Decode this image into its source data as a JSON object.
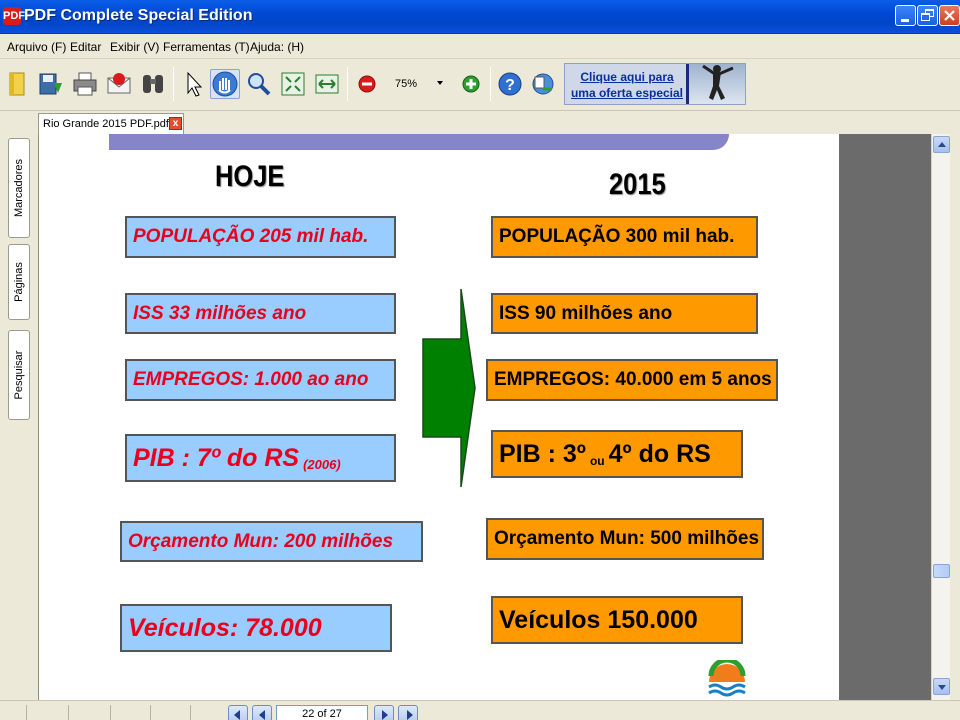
{
  "window": {
    "title": "PDF Complete Special Edition",
    "logo_text": "PDF"
  },
  "menu": [
    "Arquivo (F)",
    "Editar",
    "Exibir (V)",
    "Ferramentas (T)",
    "Ajuda: (H)"
  ],
  "toolbar": {
    "zoom": "75%",
    "tools": [
      "open-icon",
      "save-icon",
      "print-icon",
      "email-icon",
      "find-icon",
      "select-icon",
      "hand-tool-icon",
      "zoom-icon",
      "fit-page-icon",
      "fit-width-icon",
      "zoom-out-icon",
      "zoom-in-icon",
      "help-icon",
      "convert-icon"
    ],
    "ad_text": "Clique aqui para uma oferta especial"
  },
  "tab": {
    "label": "Rio Grande 2015 PDF.pdf",
    "close": "x"
  },
  "side_tabs": [
    "Marcadores",
    "Páginas",
    "Pesquisar"
  ],
  "slide": {
    "heading_left": "HOJE",
    "heading_right": "2015",
    "today": {
      "populacao": "POPULAÇÃO  205 mil hab.",
      "iss": "ISS  33 milhões ano",
      "empregos": "EMPREGOS: 1.000 ao ano",
      "pib_main": "PIB : 7º do RS",
      "pib_year": "(2006)",
      "orcamento": "Orçamento Mun: 200 milhões",
      "veiculos": "Veículos: 78.000"
    },
    "future": {
      "populacao": "POPULAÇÃO  300 mil hab.",
      "iss": "ISS  90 milhões ano",
      "empregos": "EMPREGOS: 40.000 em 5 anos",
      "pib_a": "PIB : 3º",
      "pib_ou": "ou",
      "pib_b": "4º do RS",
      "orcamento": "Orçamento Mun: 500 milhões",
      "veiculos": "Veículos 150.000"
    },
    "colors": {
      "today_box": "#99ccff",
      "today_text": "#e8001c",
      "future_box": "#ff9900",
      "arrow": "#008000"
    }
  },
  "status": {
    "page_indicator": "22 of 27"
  }
}
